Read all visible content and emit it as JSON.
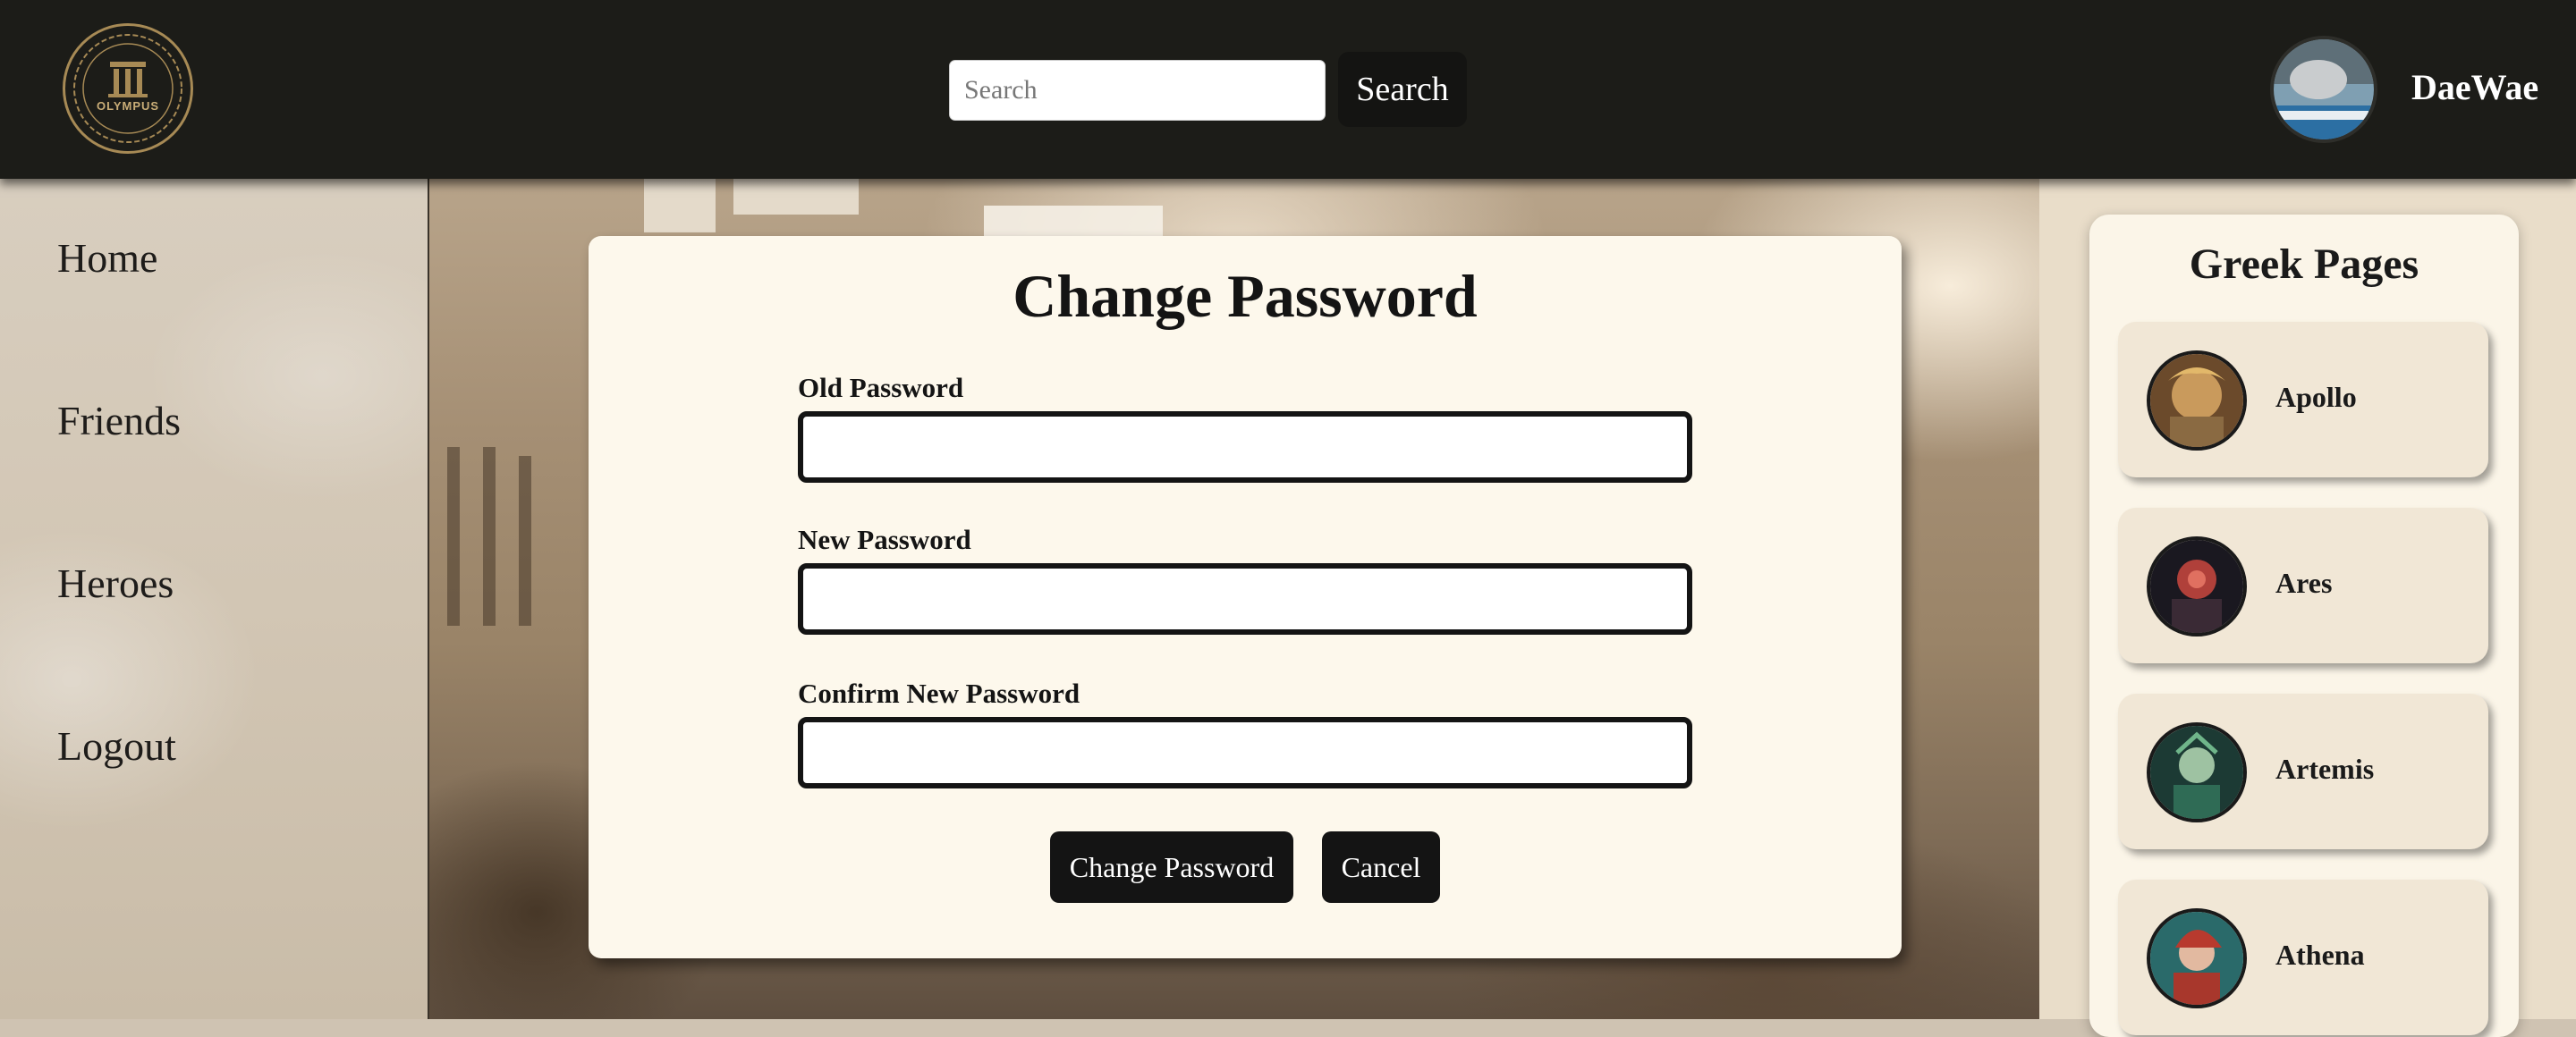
{
  "header": {
    "logo_text": "OLYMPUS",
    "search_placeholder": "Search",
    "search_value": "",
    "search_button": "Search",
    "username": "DaeWae"
  },
  "sidebar": {
    "items": [
      {
        "label": "Home"
      },
      {
        "label": "Friends"
      },
      {
        "label": "Heroes"
      },
      {
        "label": "Logout"
      }
    ]
  },
  "modal": {
    "title": "Change Password",
    "fields": [
      {
        "label": "Old Password",
        "value": ""
      },
      {
        "label": "New Password",
        "value": ""
      },
      {
        "label": "Confirm New Password",
        "value": ""
      }
    ],
    "submit_label": "Change Password",
    "cancel_label": "Cancel"
  },
  "greek_pages": {
    "title": "Greek Pages",
    "items": [
      {
        "name": "Apollo"
      },
      {
        "name": "Ares"
      },
      {
        "name": "Artemis"
      },
      {
        "name": "Athena"
      }
    ]
  },
  "colors": {
    "header_bg": "#1c1c18",
    "button_bg": "#141414",
    "modal_bg": "#fdf8ec",
    "card_bg": "#f1e7d6",
    "logo_gold": "#a78a55"
  }
}
